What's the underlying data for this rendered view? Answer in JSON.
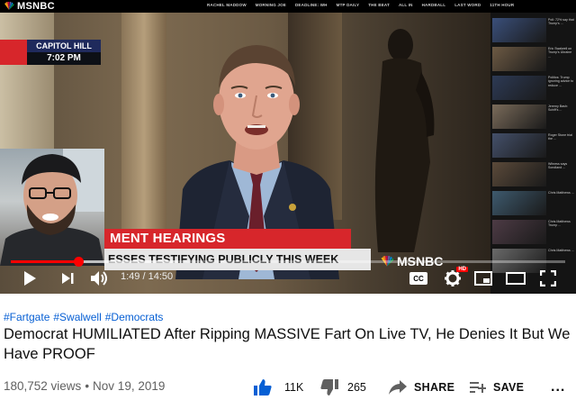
{
  "video": {
    "network": {
      "logo_text": "MSNBC"
    },
    "network_nav": [
      "RACHEL MADDOW",
      "MORNING JOE",
      "DEADLINE: WH",
      "MTP DAILY",
      "THE BEAT",
      "ALL IN",
      "HARDBALL",
      "LAST WORD",
      "11TH HOUR"
    ],
    "chyron": {
      "location": "CAPITOL HILL",
      "time": "7:02 PM"
    },
    "lower_third": {
      "headline": "MENT HEARINGS",
      "subline": "ESSES TESTIFYING PUBLICLY THIS WEEK",
      "logo_text": "MSNBC"
    },
    "sidebar_headlines": [
      "Poll: 72% say that Trump's ...",
      "Eric Swalwell on Trump's Ukraine ...",
      "Politics: Trump ignoring advice to reduce ...",
      "Jeremy Bash: Schiff's ...",
      "Roger Stone trial the ...",
      "Witness says Sondland ...",
      "Chris Matthews ...",
      "Chris Matthews Trump ...",
      "Chris Matthews ..."
    ],
    "player": {
      "time_current": "1:49",
      "time_separator": "/",
      "time_total": "14:50",
      "progress": 0.122,
      "loaded": 0.3,
      "hd_badge": "HD",
      "cc_label": "CC"
    }
  },
  "meta": {
    "hashtags": [
      "#Fartgate",
      "#Swalwell",
      "#Democrats"
    ],
    "title": "Democrat HUMILIATED After Ripping MASSIVE Fart On Live TV, He Denies It But We Have PROOF",
    "views": "180,752 views",
    "date": "Nov 19, 2019",
    "actions": {
      "like_count": "11K",
      "dislike_count": "265",
      "share_label": "SHARE",
      "save_label": "SAVE",
      "more_label": "..."
    }
  },
  "colors": {
    "progress": "#ff0000",
    "link": "#065fd4",
    "chyron_red": "#d7262b",
    "chyron_navy": "#1f2a5c",
    "like_blue": "#065fd4"
  },
  "icons": [
    "play-icon",
    "next-icon",
    "volume-icon",
    "cc-icon",
    "settings-icon",
    "miniplayer-icon",
    "theater-icon",
    "cast-icon",
    "fullscreen-icon",
    "like-icon",
    "dislike-icon",
    "share-icon",
    "save-icon",
    "more-icon"
  ]
}
